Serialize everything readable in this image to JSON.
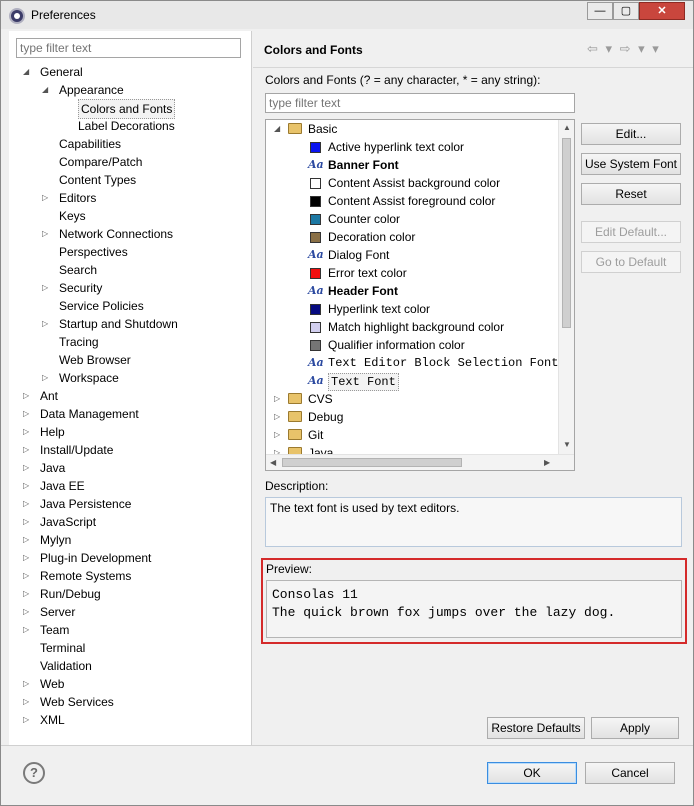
{
  "window": {
    "title": "Preferences",
    "controls": {
      "minimize": "—",
      "maximize": "▢",
      "close": "✕"
    }
  },
  "left": {
    "filter_placeholder": "type filter text",
    "tree": [
      {
        "label": "General",
        "level": 0,
        "arrow": "open"
      },
      {
        "label": "Appearance",
        "level": 1,
        "arrow": "open"
      },
      {
        "label": "Colors and Fonts",
        "level": 2,
        "arrow": "none",
        "selected": true
      },
      {
        "label": "Label Decorations",
        "level": 2,
        "arrow": "none"
      },
      {
        "label": "Capabilities",
        "level": 1,
        "arrow": "none"
      },
      {
        "label": "Compare/Patch",
        "level": 1,
        "arrow": "none"
      },
      {
        "label": "Content Types",
        "level": 1,
        "arrow": "none"
      },
      {
        "label": "Editors",
        "level": 1,
        "arrow": "closed"
      },
      {
        "label": "Keys",
        "level": 1,
        "arrow": "none"
      },
      {
        "label": "Network Connections",
        "level": 1,
        "arrow": "closed"
      },
      {
        "label": "Perspectives",
        "level": 1,
        "arrow": "none"
      },
      {
        "label": "Search",
        "level": 1,
        "arrow": "none"
      },
      {
        "label": "Security",
        "level": 1,
        "arrow": "closed"
      },
      {
        "label": "Service Policies",
        "level": 1,
        "arrow": "none"
      },
      {
        "label": "Startup and Shutdown",
        "level": 1,
        "arrow": "closed"
      },
      {
        "label": "Tracing",
        "level": 1,
        "arrow": "none"
      },
      {
        "label": "Web Browser",
        "level": 1,
        "arrow": "none"
      },
      {
        "label": "Workspace",
        "level": 1,
        "arrow": "closed"
      },
      {
        "label": "Ant",
        "level": 0,
        "arrow": "closed"
      },
      {
        "label": "Data Management",
        "level": 0,
        "arrow": "closed"
      },
      {
        "label": "Help",
        "level": 0,
        "arrow": "closed"
      },
      {
        "label": "Install/Update",
        "level": 0,
        "arrow": "closed"
      },
      {
        "label": "Java",
        "level": 0,
        "arrow": "closed"
      },
      {
        "label": "Java EE",
        "level": 0,
        "arrow": "closed"
      },
      {
        "label": "Java Persistence",
        "level": 0,
        "arrow": "closed"
      },
      {
        "label": "JavaScript",
        "level": 0,
        "arrow": "closed"
      },
      {
        "label": "Mylyn",
        "level": 0,
        "arrow": "closed"
      },
      {
        "label": "Plug-in Development",
        "level": 0,
        "arrow": "closed"
      },
      {
        "label": "Remote Systems",
        "level": 0,
        "arrow": "closed"
      },
      {
        "label": "Run/Debug",
        "level": 0,
        "arrow": "closed"
      },
      {
        "label": "Server",
        "level": 0,
        "arrow": "closed"
      },
      {
        "label": "Team",
        "level": 0,
        "arrow": "closed"
      },
      {
        "label": "Terminal",
        "level": 0,
        "arrow": "none"
      },
      {
        "label": "Validation",
        "level": 0,
        "arrow": "none"
      },
      {
        "label": "Web",
        "level": 0,
        "arrow": "closed"
      },
      {
        "label": "Web Services",
        "level": 0,
        "arrow": "closed"
      },
      {
        "label": "XML",
        "level": 0,
        "arrow": "closed"
      }
    ]
  },
  "right": {
    "title": "Colors and Fonts",
    "nav": "⇦ ▾  ⇨ ▾  ▾",
    "filter_label": "Colors and Fonts (? = any character, * = any string):",
    "filter_placeholder": "type filter text",
    "cf_tree": [
      {
        "label": "Basic",
        "kind": "folder",
        "level": 0,
        "arrow": "open"
      },
      {
        "label": "Active hyperlink text color",
        "kind": "color",
        "color": "#0a14f0",
        "level": 1
      },
      {
        "label": "Banner Font",
        "kind": "font",
        "bold": true,
        "level": 1
      },
      {
        "label": "Content Assist background color",
        "kind": "color",
        "color": "#ffffff",
        "level": 1
      },
      {
        "label": "Content Assist foreground color",
        "kind": "color",
        "color": "#000000",
        "level": 1
      },
      {
        "label": "Counter color",
        "kind": "color",
        "color": "#1c78a3",
        "level": 1
      },
      {
        "label": "Decoration color",
        "kind": "color",
        "color": "#8a7046",
        "level": 1
      },
      {
        "label": "Dialog Font",
        "kind": "font",
        "level": 1
      },
      {
        "label": "Error text color",
        "kind": "color",
        "color": "#f01010",
        "level": 1
      },
      {
        "label": "Header Font",
        "kind": "font",
        "bold": true,
        "level": 1
      },
      {
        "label": "Hyperlink text color",
        "kind": "color",
        "color": "#060a80",
        "level": 1
      },
      {
        "label": "Match highlight background color",
        "kind": "color",
        "color": "#d2cfef",
        "level": 1
      },
      {
        "label": "Qualifier information color",
        "kind": "color",
        "color": "#757575",
        "level": 1
      },
      {
        "label": "Text Editor Block Selection Font",
        "kind": "font",
        "mono": true,
        "level": 1
      },
      {
        "label": "Text Font",
        "kind": "font",
        "mono": true,
        "selected": true,
        "level": 1
      },
      {
        "label": "CVS",
        "kind": "folder",
        "level": 0,
        "arrow": "closed"
      },
      {
        "label": "Debug",
        "kind": "folder",
        "level": 0,
        "arrow": "closed"
      },
      {
        "label": "Git",
        "kind": "folder",
        "level": 0,
        "arrow": "closed"
      },
      {
        "label": "Java",
        "kind": "folder",
        "level": 0,
        "arrow": "closed"
      }
    ],
    "buttons": {
      "edit": "Edit...",
      "use_system_font": "Use System Font",
      "reset": "Reset",
      "edit_default": "Edit Default...",
      "go_to_default": "Go to Default"
    },
    "description_label": "Description:",
    "description_text": "The text font is used by text editors.",
    "preview_label": "Preview:",
    "preview_line1": "Consolas 11",
    "preview_line2": "The quick brown fox jumps over the lazy dog.",
    "restore_defaults": "Restore Defaults",
    "apply": "Apply"
  },
  "footer": {
    "help": "?",
    "ok": "OK",
    "cancel": "Cancel"
  }
}
